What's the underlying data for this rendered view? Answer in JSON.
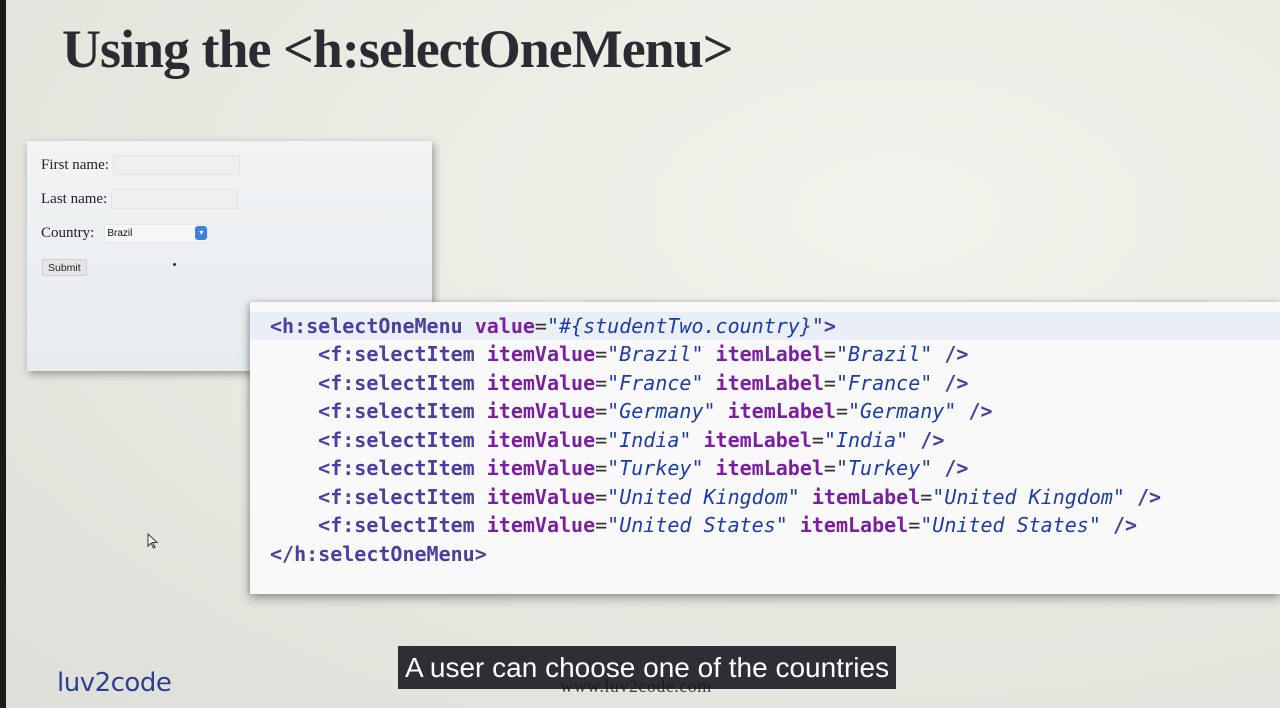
{
  "slide": {
    "title": "Using the <h:selectOneMenu>"
  },
  "form": {
    "first_name_label": "First name:",
    "last_name_label": "Last name:",
    "country_label": "Country:",
    "country_value": "Brazil",
    "submit_label": "Submit"
  },
  "code": {
    "lines": [
      [
        [
          "tag",
          "<h:selectOneMenu "
        ],
        [
          "attr",
          "value"
        ],
        [
          "eq",
          "="
        ],
        [
          "str",
          "\"#{studentTwo.country}\""
        ],
        [
          "tag",
          ">"
        ]
      ],
      [
        [
          "plain",
          "    "
        ],
        [
          "tag",
          "<f:selectItem "
        ],
        [
          "attr",
          "itemValue"
        ],
        [
          "eq",
          "="
        ],
        [
          "str",
          "\"Brazil\""
        ],
        [
          "plain",
          " "
        ],
        [
          "attr",
          "itemLabel"
        ],
        [
          "eq",
          "="
        ],
        [
          "str",
          "\"Brazil\""
        ],
        [
          "plain",
          " "
        ],
        [
          "tag",
          "/>"
        ]
      ],
      [
        [
          "plain",
          "    "
        ],
        [
          "tag",
          "<f:selectItem "
        ],
        [
          "attr",
          "itemValue"
        ],
        [
          "eq",
          "="
        ],
        [
          "str",
          "\"France\""
        ],
        [
          "plain",
          " "
        ],
        [
          "attr",
          "itemLabel"
        ],
        [
          "eq",
          "="
        ],
        [
          "str",
          "\"France\""
        ],
        [
          "plain",
          " "
        ],
        [
          "tag",
          "/>"
        ]
      ],
      [
        [
          "plain",
          "    "
        ],
        [
          "tag",
          "<f:selectItem "
        ],
        [
          "attr",
          "itemValue"
        ],
        [
          "eq",
          "="
        ],
        [
          "str",
          "\"Germany\""
        ],
        [
          "plain",
          " "
        ],
        [
          "attr",
          "itemLabel"
        ],
        [
          "eq",
          "="
        ],
        [
          "str",
          "\"Germany\""
        ],
        [
          "plain",
          " "
        ],
        [
          "tag",
          "/>"
        ]
      ],
      [
        [
          "plain",
          "    "
        ],
        [
          "tag",
          "<f:selectItem "
        ],
        [
          "attr",
          "itemValue"
        ],
        [
          "eq",
          "="
        ],
        [
          "str",
          "\"India\""
        ],
        [
          "plain",
          " "
        ],
        [
          "attr",
          "itemLabel"
        ],
        [
          "eq",
          "="
        ],
        [
          "str",
          "\"India\""
        ],
        [
          "plain",
          " "
        ],
        [
          "tag",
          "/>"
        ]
      ],
      [
        [
          "plain",
          "    "
        ],
        [
          "tag",
          "<f:selectItem "
        ],
        [
          "attr",
          "itemValue"
        ],
        [
          "eq",
          "="
        ],
        [
          "str",
          "\"Turkey\""
        ],
        [
          "plain",
          " "
        ],
        [
          "attr",
          "itemLabel"
        ],
        [
          "eq",
          "="
        ],
        [
          "str",
          "\"Turkey\""
        ],
        [
          "plain",
          " "
        ],
        [
          "tag",
          "/>"
        ]
      ],
      [
        [
          "plain",
          "    "
        ],
        [
          "tag",
          "<f:selectItem "
        ],
        [
          "attr",
          "itemValue"
        ],
        [
          "eq",
          "="
        ],
        [
          "str",
          "\"United Kingdom\""
        ],
        [
          "plain",
          " "
        ],
        [
          "attr",
          "itemLabel"
        ],
        [
          "eq",
          "="
        ],
        [
          "str",
          "\"United Kingdom\""
        ],
        [
          "plain",
          " "
        ],
        [
          "tag",
          "/>"
        ]
      ],
      [
        [
          "plain",
          "    "
        ],
        [
          "tag",
          "<f:selectItem "
        ],
        [
          "attr",
          "itemValue"
        ],
        [
          "eq",
          "="
        ],
        [
          "str",
          "\"United States\""
        ],
        [
          "plain",
          " "
        ],
        [
          "attr",
          "itemLabel"
        ],
        [
          "eq",
          "="
        ],
        [
          "str",
          "\"United States\""
        ],
        [
          "plain",
          " "
        ],
        [
          "tag",
          "/>"
        ]
      ],
      [
        [
          "tag",
          "</h:selectOneMenu>"
        ]
      ]
    ]
  },
  "footer": {
    "logo_text": "luv2code",
    "website": "www.luv2code.com"
  },
  "caption": "A user can choose one of the countries",
  "icons": {
    "select_arrow": "dropdown-arrow-icon",
    "pointer": "mouse-pointer-icon"
  },
  "colors": {
    "tag": "#4a3fa0",
    "attr": "#7b1fa2",
    "string": "#1c3ca7",
    "select_accent": "#3b7fe0",
    "logo": "#2e3f8f"
  }
}
